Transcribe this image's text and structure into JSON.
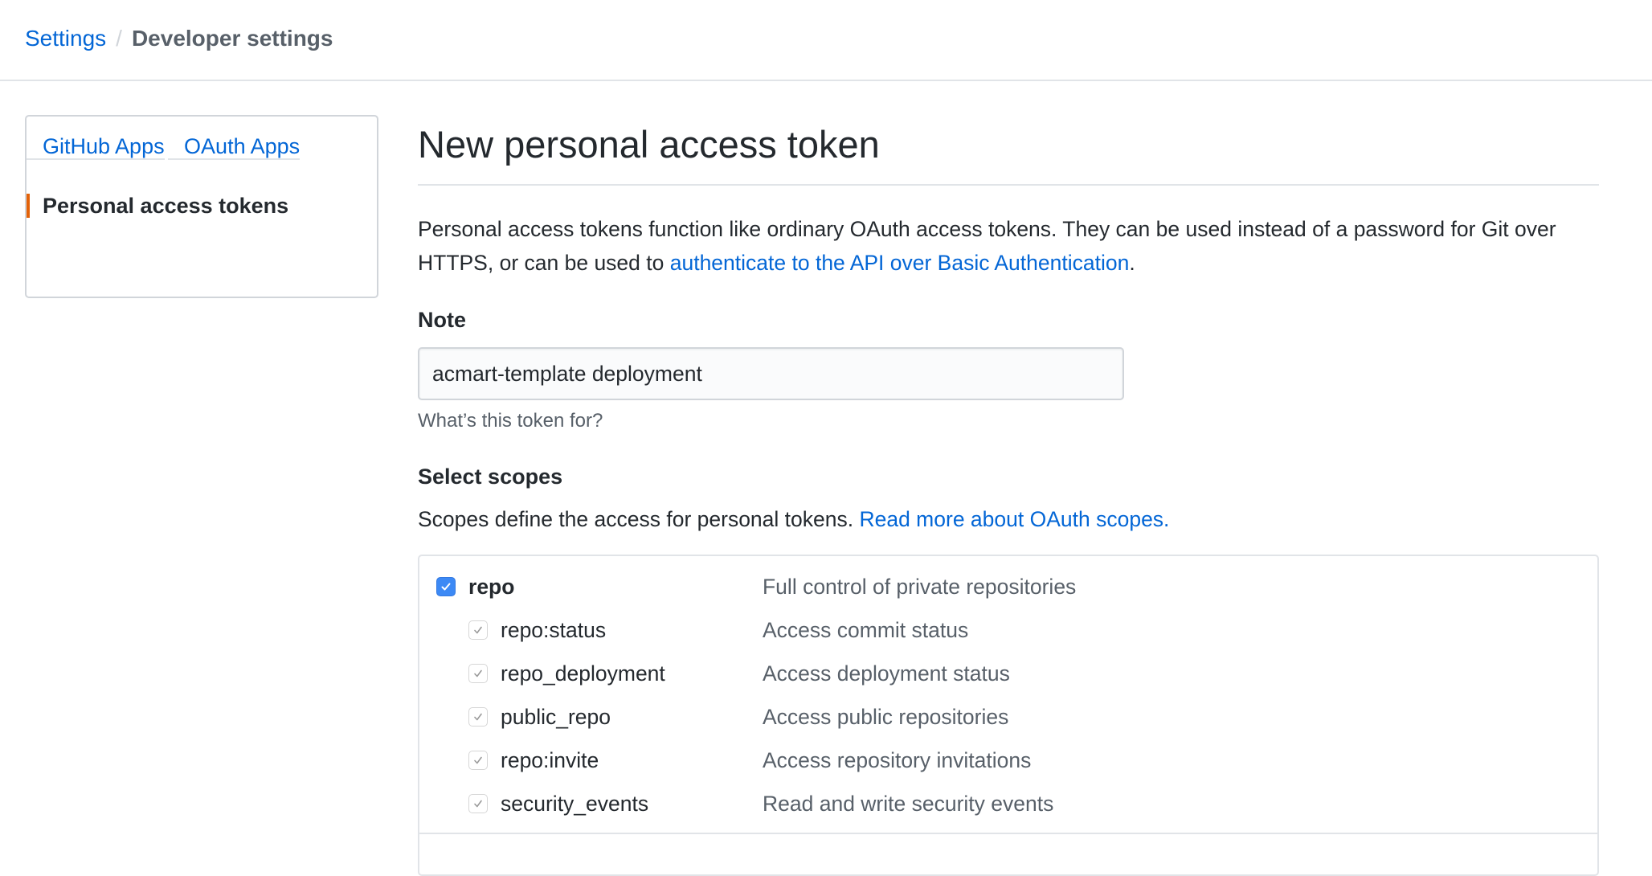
{
  "breadcrumb": {
    "parent": "Settings",
    "separator": "/",
    "current": "Developer settings"
  },
  "sidebar": {
    "items": [
      {
        "label": "GitHub Apps",
        "selected": false
      },
      {
        "label": "OAuth Apps",
        "selected": false
      },
      {
        "label": "Personal access tokens",
        "selected": true
      }
    ]
  },
  "main": {
    "title": "New personal access token",
    "intro_text": "Personal access tokens function like ordinary OAuth access tokens. They can be used instead of a password for Git over HTTPS, or can be used to ",
    "intro_link": "authenticate to the API over Basic Authentication",
    "intro_end": ".",
    "note": {
      "label": "Note",
      "value": "acmart-template deployment",
      "hint": "What’s this token for?"
    },
    "scopes": {
      "label": "Select scopes",
      "description": "Scopes define the access for personal tokens. ",
      "link": "Read more about OAuth scopes.",
      "items": [
        {
          "name": "repo",
          "description": "Full control of private repositories",
          "checked": true,
          "level": "primary"
        },
        {
          "name": "repo:status",
          "description": "Access commit status",
          "checked": true,
          "level": "sub"
        },
        {
          "name": "repo_deployment",
          "description": "Access deployment status",
          "checked": true,
          "level": "sub"
        },
        {
          "name": "public_repo",
          "description": "Access public repositories",
          "checked": true,
          "level": "sub"
        },
        {
          "name": "repo:invite",
          "description": "Access repository invitations",
          "checked": true,
          "level": "sub"
        },
        {
          "name": "security_events",
          "description": "Read and write security events",
          "checked": true,
          "level": "sub"
        }
      ]
    }
  },
  "colors": {
    "link": "#0366d6",
    "text": "#24292e",
    "muted": "#586069",
    "selected_accent": "#e36209",
    "checkbox_checked": "#3c89f5",
    "border": "#e1e4e8"
  }
}
